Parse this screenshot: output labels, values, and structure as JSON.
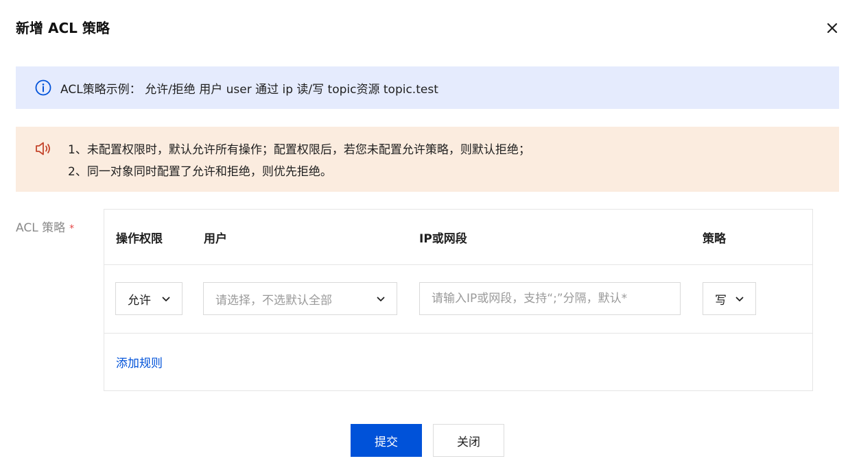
{
  "dialog": {
    "title": "新增 ACL 策略",
    "close_icon": "close-icon"
  },
  "info": {
    "icon": "info-circle-icon",
    "text": "ACL策略示例：  允许/拒绝 用户 user 通过 ip 读/写 topic资源 topic.test"
  },
  "notice": {
    "icon": "speaker-icon",
    "line1": "1、未配置权限时，默认允许所有操作；配置权限后，若您未配置允许策略，则默认拒绝；",
    "line2": "2、同一对象同时配置了允许和拒绝，则优先拒绝。"
  },
  "form": {
    "label": "ACL 策略",
    "required_mark": "*"
  },
  "table": {
    "columns": [
      "操作权限",
      "用户",
      "IP或网段",
      "策略"
    ],
    "rows": [
      {
        "permission": "允许",
        "user_placeholder": "请选择，不选默认全部",
        "ip_placeholder": "请输入IP或网段，支持“;”分隔，默认*",
        "ip_value": "",
        "policy": "写"
      }
    ],
    "add_rule": "添加规则"
  },
  "footer": {
    "submit": "提交",
    "close": "关闭"
  },
  "colors": {
    "primary": "#0052d9",
    "info_bg": "#e5ebfd",
    "warning_bg": "#fbecdf",
    "warning_icon": "#c4442b",
    "required": "#e54545"
  }
}
